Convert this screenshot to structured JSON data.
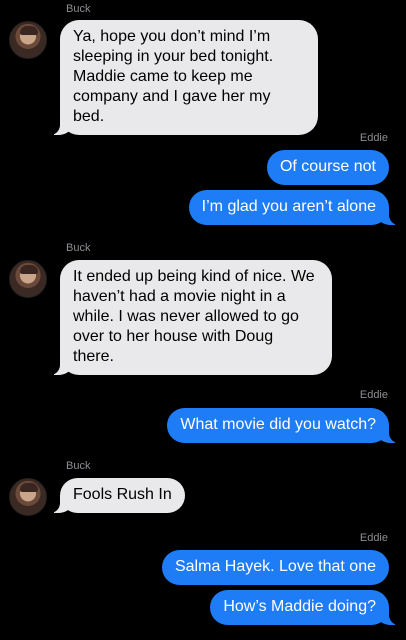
{
  "conversation": {
    "messages": [
      {
        "sender": "Buck",
        "text": "Ya, hope you don’t mind I’m\nsleeping in your bed tonight.\nMaddie came to keep me\ncompany and I gave her my bed."
      },
      {
        "sender": "Eddie",
        "text": "Of course not"
      },
      {
        "sender": "Eddie",
        "text": "I’m glad you aren’t alone"
      },
      {
        "sender": "Buck",
        "text": "It ended up being kind of nice. We\nhaven’t had a movie night in a\nwhile. I was never allowed to go\nover to her house with Doug\nthere."
      },
      {
        "sender": "Eddie",
        "text": "What movie did you watch?"
      },
      {
        "sender": "Buck",
        "text": "Fools Rush In"
      },
      {
        "sender": "Eddie",
        "text": "Salma Hayek. Love that one"
      },
      {
        "sender": "Eddie",
        "text": "How’s Maddie doing?"
      }
    ]
  },
  "colors": {
    "background": "#000000",
    "incoming_bubble": "#e9e9eb",
    "outgoing_bubble": "#1f7cf7",
    "sender_label": "#8e8e93"
  }
}
